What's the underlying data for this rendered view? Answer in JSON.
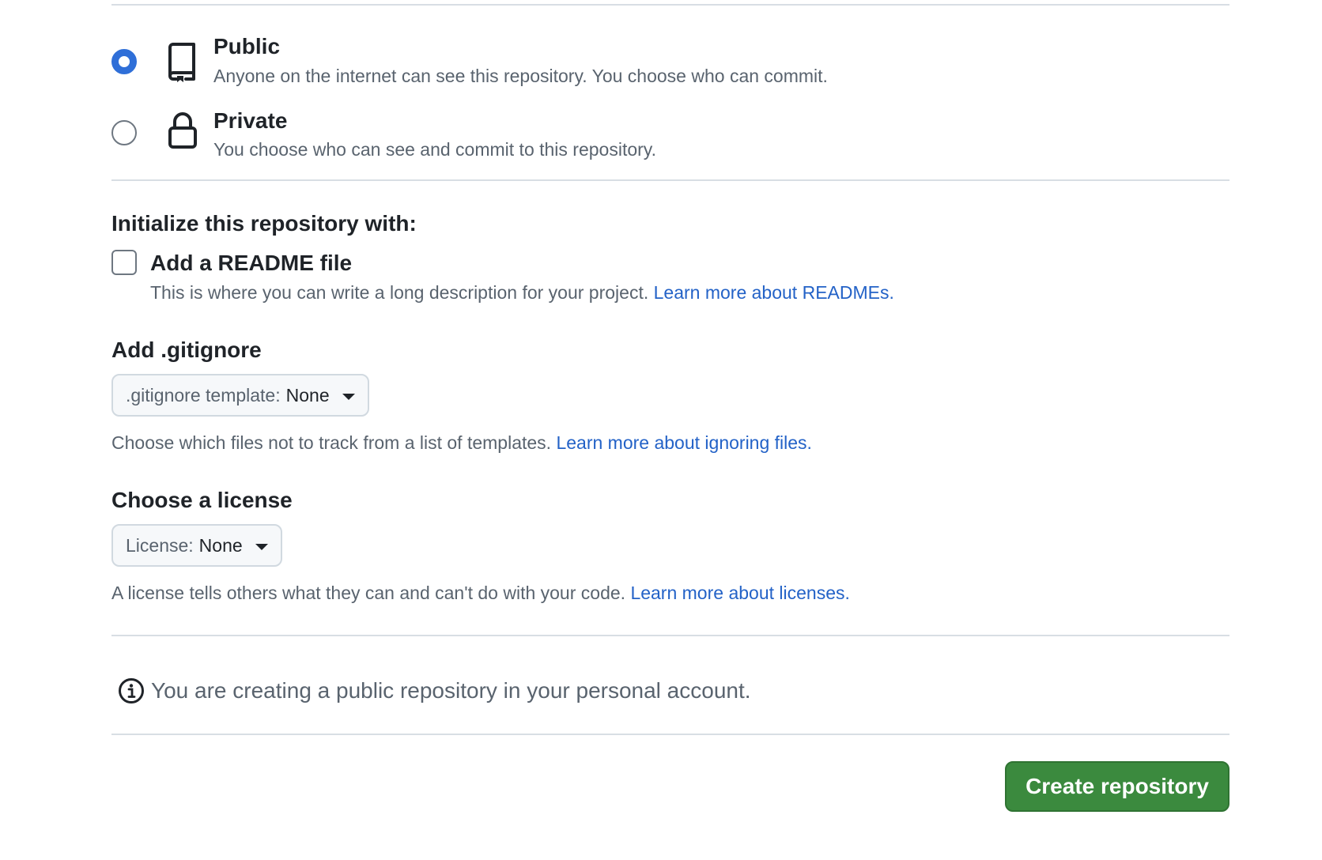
{
  "visibility": {
    "options": [
      {
        "title": "Public",
        "description": "Anyone on the internet can see this repository. You choose who can commit.",
        "selected": true,
        "icon": "repo-icon"
      },
      {
        "title": "Private",
        "description": "You choose who can see and commit to this repository.",
        "selected": false,
        "icon": "lock-icon"
      }
    ]
  },
  "initialize": {
    "heading": "Initialize this repository with:",
    "readme": {
      "label": "Add a README file",
      "checked": false,
      "help": "This is where you can write a long description for your project.",
      "link": "Learn more about READMEs."
    }
  },
  "gitignore": {
    "heading": "Add .gitignore",
    "select_prefix": ".gitignore template:",
    "select_value": "None",
    "help": "Choose which files not to track from a list of templates.",
    "link": "Learn more about ignoring files."
  },
  "license": {
    "heading": "Choose a license",
    "select_prefix": "License:",
    "select_value": "None",
    "help": "A license tells others what they can and can't do with your code.",
    "link": "Learn more about licenses."
  },
  "notice": {
    "text": "You are creating a public repository in your personal account.",
    "icon": "info-icon"
  },
  "actions": {
    "create_label": "Create repository"
  },
  "colors": {
    "accent": "#2f6fd8",
    "link": "#2362c7",
    "primary_button": "#3b8a3e"
  }
}
